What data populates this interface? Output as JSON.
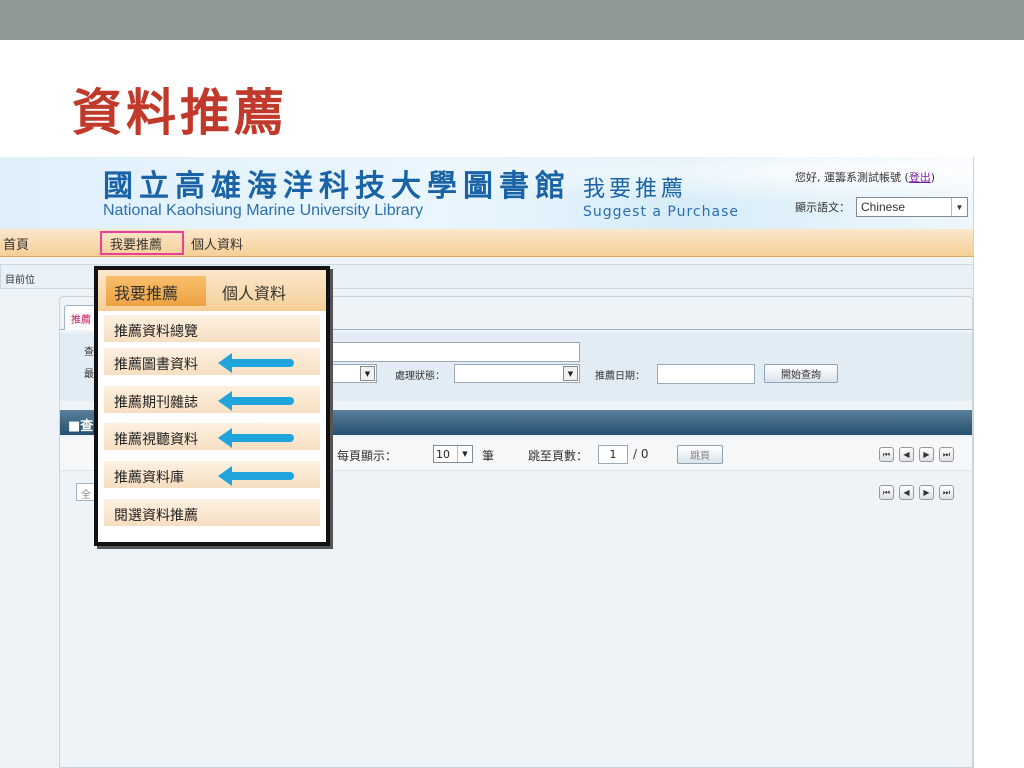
{
  "slide_title": "資料推薦",
  "header": {
    "library_name_cn": "國立高雄海洋科技大學圖書館",
    "library_name_en": "National Kaohsiung Marine University Library",
    "section_cn": "我要推薦",
    "section_en": "Suggest a Purchase",
    "greeting": "您好, 運籌系測試帳號 (",
    "logout_label": "登出",
    "greeting_end": ")",
    "language_label": "顯示語文：",
    "language_value": "Chinese"
  },
  "nav": {
    "home": "首頁",
    "suggest": "我要推薦",
    "profile": "個人資料"
  },
  "breadcrumb": "目前位",
  "tab_label": "推薦",
  "query": {
    "label_a": "查",
    "label_b": "最",
    "status_label": "處理狀態：",
    "date_label": "推薦日期：",
    "start_button": "開始查詢"
  },
  "results": {
    "header_label": "■查",
    "per_page_label": "每頁顯示：",
    "per_page_value": "10",
    "unit": "筆",
    "goto_label": "跳至頁數：",
    "page_value": "1",
    "total": "/ 0",
    "jump_button": "跳頁",
    "select_all": "全"
  },
  "dropdown": {
    "header_active": "我要推薦",
    "header_other": "個人資料",
    "items": [
      "推薦資料總覽",
      "推薦圖書資料",
      "推薦期刊雜誌",
      "推薦視聽資料",
      "推薦資料庫",
      "閱選資料推薦"
    ]
  },
  "colors": {
    "title_red": "#c0392b",
    "nav_orange": "#f5cf96",
    "highlight_pink": "#e8419a",
    "arrow_blue": "#1fa4dc",
    "results_bar": "#24506f"
  }
}
